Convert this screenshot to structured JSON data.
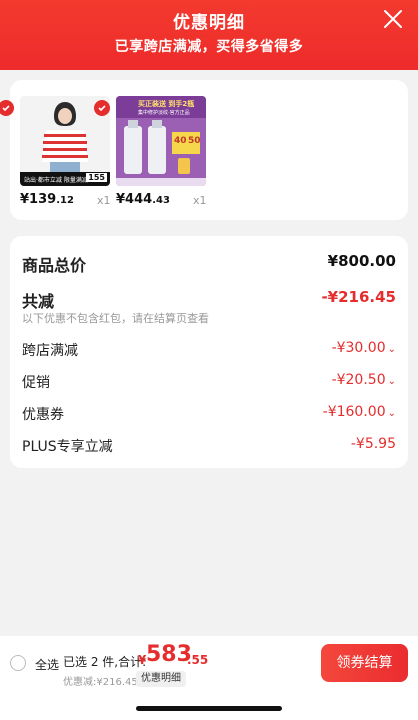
{
  "header": {
    "title": "优惠明细",
    "subtitle": "已享跨店满减，买得多省得多"
  },
  "products": [
    {
      "price_main": "¥139",
      "price_dec": ".12",
      "qty": "x1",
      "banner_left": "155",
      "banner_text": "站出·都市立减 限量满减"
    },
    {
      "price_main": "¥444",
      "price_dec": ".43",
      "qty": "x1",
      "promo_line1": "买正装送 到手2瓶",
      "promo_line2": "集中修护淡纹·官方正品",
      "promo_badge_1": "40",
      "promo_badge_2": "50"
    }
  ],
  "summary": {
    "subtotal_label": "商品总价",
    "subtotal_value": "¥800.00",
    "total_discount_label": "共减",
    "total_discount_value": "-¥216.45",
    "note": "以下优惠不包含红包，请在结算页查看",
    "items": [
      {
        "label": "跨店满减",
        "value": "-¥30.00"
      },
      {
        "label": "促销",
        "value": "-¥20.50"
      },
      {
        "label": "优惠券",
        "value": "-¥160.00"
      },
      {
        "label": "PLUS专享立减",
        "value": "-¥5.95"
      }
    ]
  },
  "bottom": {
    "select_all": "全选",
    "selected_text": "已选 2 件,合计:",
    "total_symbol": "¥",
    "total_int": "583",
    "total_dec": ".55",
    "discount_text": "优惠减:¥216.45",
    "detail_tag": "优惠明细",
    "pay_button": "领券结算"
  },
  "colors": {
    "accent": "#e52d2d",
    "header": "#f03a2e"
  }
}
